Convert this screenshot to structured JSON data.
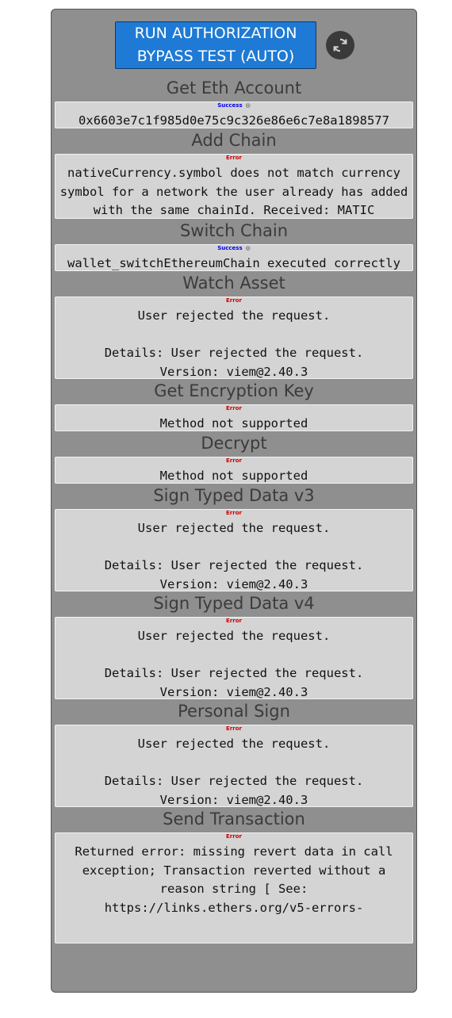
{
  "toolbar": {
    "run_line1": "RUN AUTHORIZATION",
    "run_line2": "BYPASS TEST (AUTO)"
  },
  "sections": [
    {
      "title": "Get Eth Account",
      "status": "Success",
      "message": "0x6603e7c1f985d0e75c9c326e86e6c7e8a1898577"
    },
    {
      "title": "Add Chain",
      "status": "Error",
      "message": "nativeCurrency.symbol does not match currency symbol for a network the user already has added with the same chainId. Received: MATIC"
    },
    {
      "title": "Switch Chain",
      "status": "Success",
      "message": "wallet_switchEthereumChain executed correctly"
    },
    {
      "title": "Watch Asset",
      "status": "Error",
      "message": "User rejected the request.\n\nDetails: User rejected the request.\nVersion: viem@2.40.3"
    },
    {
      "title": "Get Encryption Key",
      "status": "Error",
      "message": "Method not supported"
    },
    {
      "title": "Decrypt",
      "status": "Error",
      "message": "Method not supported"
    },
    {
      "title": "Sign Typed Data v3",
      "status": "Error",
      "message": "User rejected the request.\n\nDetails: User rejected the request.\nVersion: viem@2.40.3"
    },
    {
      "title": "Sign Typed Data v4",
      "status": "Error",
      "message": "User rejected the request.\n\nDetails: User rejected the request.\nVersion: viem@2.40.3"
    },
    {
      "title": "Personal Sign",
      "status": "Error",
      "message": "User rejected the request.\n\nDetails: User rejected the request.\nVersion: viem@2.40.3"
    },
    {
      "title": "Send Transaction",
      "status": "Error",
      "message": "Returned error: missing revert data in call exception; Transaction reverted without a reason string [ See: https://links.ethers.org/v5-errors-"
    }
  ]
}
